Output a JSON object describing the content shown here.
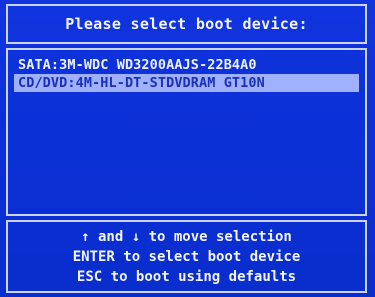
{
  "title": "Please select boot device:",
  "devices": [
    {
      "label": "SATA:3M-WDC WD3200AAJS-22B4A0",
      "selected": false
    },
    {
      "label": "CD/DVD:4M-HL-DT-STDVDRAM GT10N",
      "selected": true
    }
  ],
  "help": {
    "line1": "↑ and ↓ to move selection",
    "line2": "ENTER to select boot device",
    "line3": "ESC to boot using defaults"
  },
  "colors": {
    "background": "#0b30d6",
    "border": "#c9d3ff",
    "text": "#eef2ff",
    "selection_background": "#9fb0ff",
    "selection_text": "#1b2fb8"
  }
}
